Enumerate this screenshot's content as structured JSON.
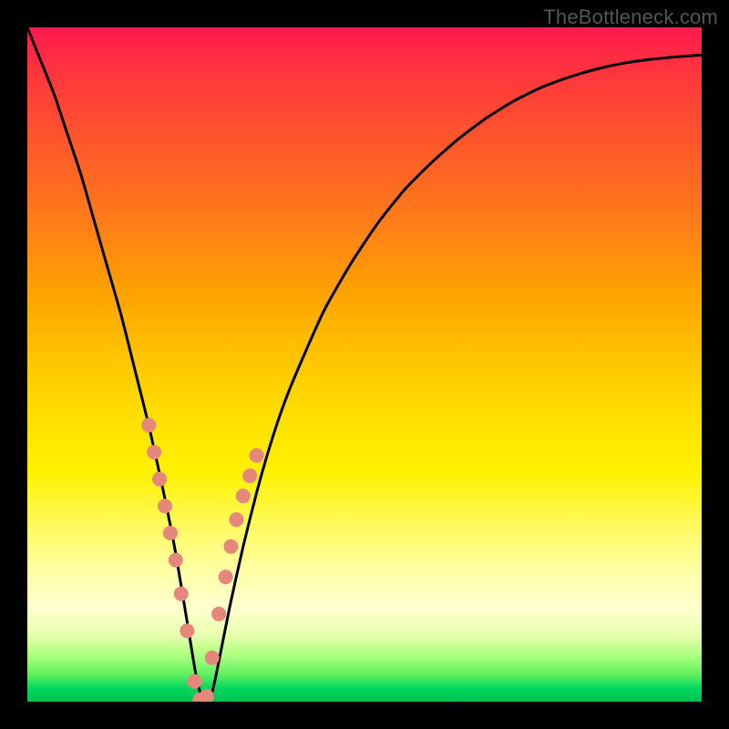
{
  "watermark": "TheBottleneck.com",
  "colors": {
    "background": "#000000",
    "curve": "#000000",
    "marker": "#e6877c",
    "gradient_top": "#ff1a4d",
    "gradient_bottom": "#00c050"
  },
  "chart_data": {
    "type": "line",
    "title": "",
    "xlabel": "",
    "ylabel": "",
    "xlim": [
      0,
      100
    ],
    "ylim": [
      0,
      100
    ],
    "series": [
      {
        "name": "bottleneck-curve",
        "x": [
          0,
          2,
          4,
          6,
          8,
          10,
          12,
          14,
          16,
          18,
          20,
          22,
          24,
          25,
          26,
          27,
          28,
          30,
          32,
          34,
          36,
          38,
          40,
          44,
          48,
          52,
          56,
          60,
          64,
          68,
          72,
          76,
          80,
          84,
          88,
          92,
          96,
          100
        ],
        "values": [
          100,
          95,
          90,
          84,
          78,
          71,
          64,
          57,
          49,
          41,
          32,
          22,
          10,
          4,
          0,
          0,
          4,
          14,
          23,
          31,
          38,
          44,
          49,
          58,
          65,
          71,
          76,
          80,
          83.5,
          86.5,
          89,
          91,
          92.5,
          93.7,
          94.6,
          95.2,
          95.6,
          95.9
        ]
      }
    ],
    "markers": {
      "name": "highlighted-points",
      "x": [
        18.0,
        18.8,
        19.6,
        20.4,
        21.2,
        22.0,
        22.8,
        23.7,
        24.8,
        25.6,
        26.6,
        27.4,
        28.4,
        29.4,
        30.2,
        31.0,
        32.0,
        33.0,
        34.0
      ],
      "values": [
        41.0,
        37.0,
        33.0,
        29.0,
        25.0,
        21.0,
        16.0,
        10.5,
        3.0,
        0.3,
        0.8,
        6.5,
        13.0,
        18.5,
        23.0,
        27.0,
        30.5,
        33.5,
        36.5
      ]
    },
    "notes": "Values are percentages read from the plot by position; vertical axis increases upward from the green band at bottom (0) to the red band at top (100). The curve minimum (0) occurs near x≈25–27. Axes have no visible tick labels in the source image."
  }
}
